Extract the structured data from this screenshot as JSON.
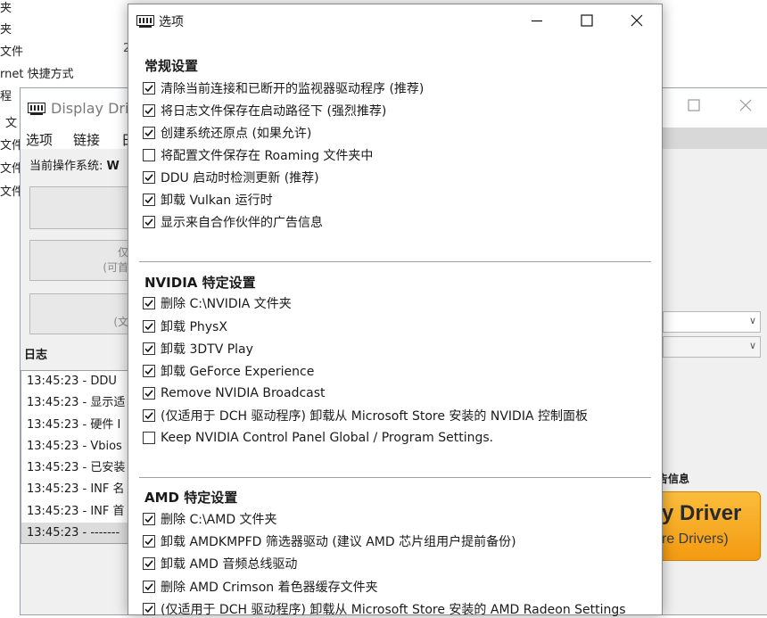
{
  "explorer": {
    "items": [
      "夹",
      "夹",
      "文件",
      "rnet 快捷方式",
      "程",
      "文",
      "文件",
      "文件",
      "文件"
    ],
    "size_digit": "2"
  },
  "background_window": {
    "title": "Display Driv",
    "menu": [
      "选项",
      "链接",
      "日"
    ],
    "os_label": "当前操作系统:",
    "os_value": "W",
    "buttons": [
      {
        "line1": "",
        "line2": ""
      },
      {
        "line1": "仅",
        "line2": "(可首"
      },
      {
        "line1": "",
        "line2": "(文"
      }
    ],
    "log_label": "日志",
    "log_lines": [
      "13:45:23 - DDU",
      "13:45:23 - 显示适",
      "13:45:23 - 硬件 I",
      "13:45:23 - Vbios",
      "13:45:23 - 已安装",
      "13:45:23 - INF 名",
      "13:45:23 - INF 首",
      "13:45:23 - -------"
    ],
    "donate_label": "告信息",
    "banner": {
      "line1": "y Driver",
      "line2": "re Drivers)"
    }
  },
  "dialog": {
    "title": "选项",
    "sections": [
      {
        "title": "常规设置",
        "options": [
          {
            "label": "清除当前连接和已断开的监视器驱动程序 (推荐)",
            "checked": true
          },
          {
            "label": "将日志文件保存在启动路径下 (强烈推荐)",
            "checked": true
          },
          {
            "label": "创建系统还原点 (如果允许)",
            "checked": true
          },
          {
            "label": "将配置文件保存在 Roaming 文件夹中",
            "checked": false
          },
          {
            "label": "DDU 启动时检测更新 (推荐)",
            "checked": true
          },
          {
            "label": "卸载 Vulkan 运行时",
            "checked": true
          },
          {
            "label": "显示来自合作伙伴的广告信息",
            "checked": true
          }
        ]
      },
      {
        "title": "NVIDIA 特定设置",
        "options": [
          {
            "label": "删除 C:\\NVIDIA 文件夹",
            "checked": true
          },
          {
            "label": "卸载 PhysX",
            "checked": true
          },
          {
            "label": "卸载 3DTV Play",
            "checked": true
          },
          {
            "label": "卸载 GeForce Experience",
            "checked": true
          },
          {
            "label": "Remove NVIDIA Broadcast",
            "checked": true
          },
          {
            "label": "(仅适用于 DCH 驱动程序) 卸载从 Microsoft Store 安装的 NVIDIA 控制面板",
            "checked": true
          },
          {
            "label": "Keep NVIDIA Control Panel Global / Program Settings.",
            "checked": false
          }
        ]
      },
      {
        "title": "AMD 特定设置",
        "options": [
          {
            "label": "删除 C:\\AMD 文件夹",
            "checked": true
          },
          {
            "label": "卸载 AMDKMPFD 筛选器驱动 (建议 AMD 芯片组用户提前备份)",
            "checked": true
          },
          {
            "label": "卸载 AMD 音频总线驱动",
            "checked": true
          },
          {
            "label": "删除 AMD Crimson 着色器缓存文件夹",
            "checked": true
          },
          {
            "label": "(仅适用于 DCH 驱动程序) 卸载从 Microsoft Store 安装的 AMD Radeon Settings",
            "checked": true
          }
        ]
      }
    ]
  },
  "colors": {
    "banner_orange": "#f5a623",
    "dialog_background": "#ffffff",
    "window_background": "#f0f0f0"
  }
}
